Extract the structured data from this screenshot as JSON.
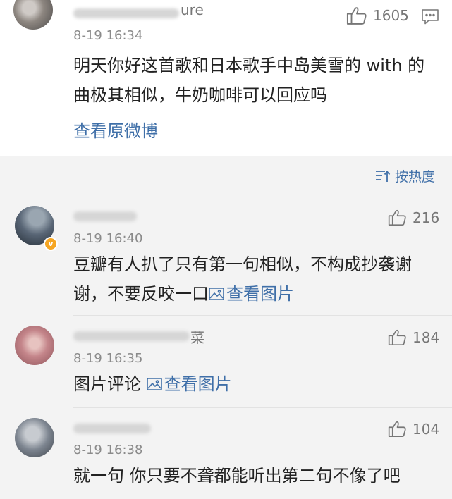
{
  "main_comment": {
    "username_tail": "ure",
    "time": "8-19 16:34",
    "text": "明天你好这首歌和日本歌手中岛美雪的 with 的曲极其相似，牛奶咖啡可以回应吗",
    "likes": "1605",
    "view_original_label": "查看原微博"
  },
  "sort_label": "按热度",
  "replies": [
    {
      "time": "8-19 16:40",
      "text": "豆瓣有人扒了只有第一句相似，不构成抄袭谢谢，不要反咬一口",
      "pic_label": "查看图片",
      "likes": "216",
      "badge": "v"
    },
    {
      "username_tail": "菜",
      "time": "8-19 16:35",
      "text": "图片评论",
      "pic_label": "查看图片",
      "likes": "184"
    },
    {
      "time": "8-19 16:38",
      "text": "就一句 你只要不聋都能听出第二句不像了吧",
      "likes": "104"
    }
  ],
  "icons": {
    "like": "thumbs-up-icon",
    "comment": "message-icon",
    "sort": "sort-icon",
    "image": "image-icon"
  },
  "colors": {
    "link": "#3f6fa8",
    "verified_badge": "#f6a623"
  }
}
